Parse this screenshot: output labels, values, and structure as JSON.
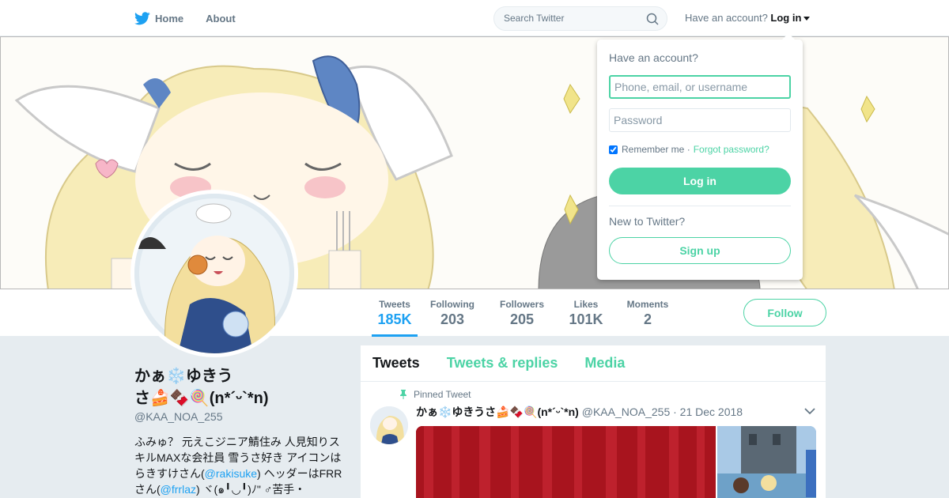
{
  "nav": {
    "home_label": "Home",
    "about_label": "About",
    "search_placeholder": "Search Twitter",
    "have_account": "Have an account?",
    "login_label": "Log in"
  },
  "colors": {
    "accent": "#4cd3a5",
    "link_blue": "#1da1f2",
    "twitter_blue": "#1da1f2",
    "background": "#e6ecf0"
  },
  "stats": [
    {
      "label": "Tweets",
      "value": "185K",
      "active": true
    },
    {
      "label": "Following",
      "value": "203",
      "active": false
    },
    {
      "label": "Followers",
      "value": "205",
      "active": false
    },
    {
      "label": "Likes",
      "value": "101K",
      "active": false
    },
    {
      "label": "Moments",
      "value": "2",
      "active": false
    }
  ],
  "follow_label": "Follow",
  "profile": {
    "name_line1": "かぁ❄️ゆきう",
    "name_line2": "さ🍰🍫🍭(n*´ᵕ`*n)",
    "handle": "@KAA_NOA_255",
    "bio_part1": "ふみゅ？ 元えこジニア鯖住み 人見知りスキルMAXな会社員 雪うさ好き アイコンはらきすけさん(",
    "bio_mention1": "@rakisuke",
    "bio_part2": ") ヘッダーはFRRさん(",
    "bio_mention2": "@frrlaz",
    "bio_part3": ") ヾ(๑╹◡╹)ﾉ\" ♂苦手・"
  },
  "timeline": {
    "tabs": [
      "Tweets",
      "Tweets & replies",
      "Media"
    ],
    "pinned_label": "Pinned Tweet",
    "tweet": {
      "name": "かぁ❄️ゆきうさ🍰🍫🍭(n*´ᵕ`*n)",
      "handle": "@KAA_NOA_255",
      "date": "· 21 Dec 2018"
    }
  },
  "login_dropdown": {
    "title": "Have an account?",
    "username_placeholder": "Phone, email, or username",
    "password_placeholder": "Password",
    "remember_label": "Remember me",
    "separator": "·",
    "forgot_label": "Forgot password?",
    "login_button": "Log in",
    "new_label": "New to Twitter?",
    "signup_button": "Sign up"
  },
  "icons": {
    "logo": "twitter-bird-icon",
    "search": "search-icon",
    "pin": "pin-icon",
    "caret": "chevron-down-icon"
  }
}
